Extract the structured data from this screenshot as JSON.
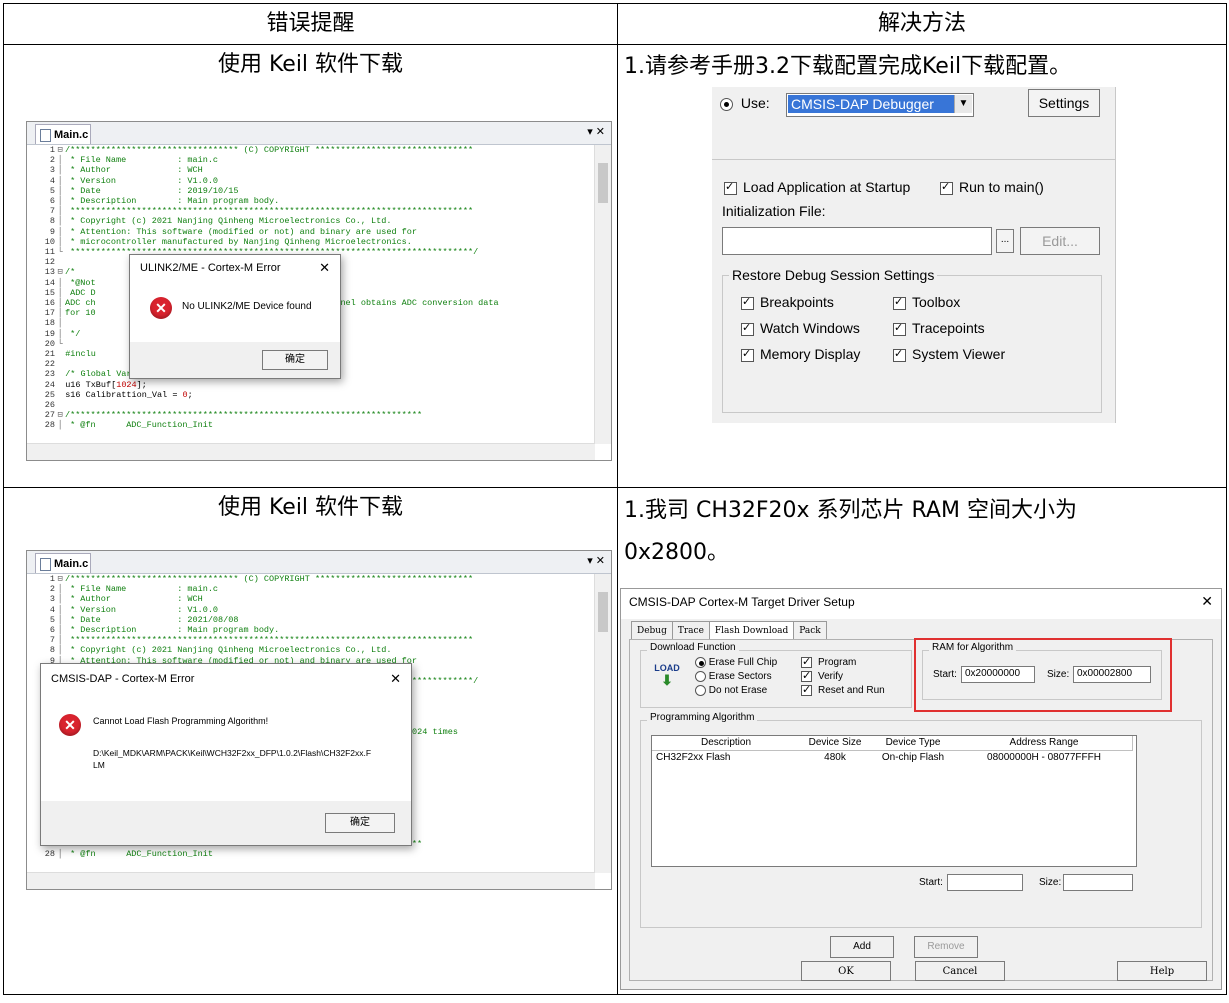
{
  "table": {
    "headers": [
      "错误提醒",
      "解决方法"
    ]
  },
  "row1": {
    "left_title": "使用 Keil 软件下载",
    "right_text": "1.请参考手册3.2下载配置完成Keil下载配置。",
    "editor": {
      "tab": "Main.c",
      "dates": "2019/10/15"
    },
    "dialog": {
      "title": "ULINK2/ME - Cortex-M Error",
      "message": "No ULINK2/ME Device found",
      "ok": "确定"
    },
    "debug_settings": {
      "use_label": "Use:",
      "debugger": "CMSIS-DAP Debugger",
      "settings_btn": "Settings",
      "load_app": "Load Application at Startup",
      "run_to_main": "Run to main()",
      "init_file": "Initialization File:",
      "browse_btn": "...",
      "edit_btn": "Edit...",
      "restore_group": "Restore Debug Session Settings",
      "breakpoints": "Breakpoints",
      "toolbox": "Toolbox",
      "watch_windows": "Watch Windows",
      "tracepoints": "Tracepoints",
      "memory_display": "Memory Display",
      "system_viewer": "System Viewer"
    }
  },
  "row2": {
    "left_title": "使用 Keil 软件下载",
    "right_text_1": "1.我司 CH32F20x 系列芯片 RAM 空间大小为",
    "right_text_2": "0x2800。",
    "editor": {
      "tab": "Main.c"
    },
    "dialog": {
      "title": "CMSIS-DAP - Cortex-M Error",
      "message": "Cannot Load Flash Programming Algorithm!",
      "path_1": "D:\\Keil_MDK\\ARM\\PACK\\Keil\\WCH32F2xx_DFP\\1.0.2\\Flash\\CH32F2xx.F",
      "path_2": "LM",
      "ok": "确定",
      "behind_text": "ns 1024 times"
    },
    "target_setup": {
      "title": "CMSIS-DAP Cortex-M Target Driver Setup",
      "tabs": [
        "Debug",
        "Trace",
        "Flash Download",
        "Pack"
      ],
      "download_function": "Download Function",
      "load_icon": "LOAD",
      "erase_full_chip": "Erase Full Chip",
      "erase_sectors": "Erase Sectors",
      "do_not_erase": "Do not Erase",
      "program": "Program",
      "verify": "Verify",
      "reset_and_run": "Reset and Run",
      "ram_group": "RAM for Algorithm",
      "start_label": "Start:",
      "start_value": "0x20000000",
      "size_label": "Size:",
      "size_value": "0x00002800",
      "prog_algo": "Programming Algorithm",
      "col_description": "Description",
      "col_device_size": "Device Size",
      "col_device_type": "Device Type",
      "col_address_range": "Address Range",
      "row_description": "CH32F2xx Flash",
      "row_device_size": "480k",
      "row_device_type": "On-chip Flash",
      "row_address_range": "08000000H - 08077FFFH",
      "start2": "Start:",
      "size2": "Size:",
      "add_btn": "Add",
      "remove_btn": "Remove",
      "ok_btn": "OK",
      "cancel_btn": "Cancel",
      "help_btn": "Help"
    }
  },
  "code_common": {
    "l1": "/********************************* (C) COPYRIGHT *******************************",
    "l2": " * File Name          : main.c",
    "l3": " * Author             : WCH",
    "l4": " * Version            : V1.0.0",
    "l5_label": " * Date               : ",
    "l5_date_a": "2019/10/15",
    "l5_date_b": "2021/08/08",
    "l6": " * Description        : Main program body.",
    "l7": " *******************************************************************************",
    "l8": " * Copyright (c) 2021 Nanjing Qinheng Microelectronics Co., Ltd.",
    "l9": " * Attention: This software (modified or not) and binary are used for",
    "l10": " * microcontroller manufactured by Nanjing Qinheng Microelectronics.",
    "l11": " *******************************************************************************/",
    "l13": "/*",
    "l14": " *@Not",
    "l15": " ADC D",
    "l16a": "ADC ch",
    "l16b": "annel obtains ADC conversion data",
    "l17": "for 10",
    "l19": " */",
    "l21": "#inclu",
    "l23": "/* Global Variable */",
    "l24a": "u16 TxBuf[",
    "l24n": "1024",
    "l24b": "];",
    "l25a": "s16 Calibrattion_Val = ",
    "l25n": "0",
    "l25b": ";",
    "l27": "/*********************************************************************",
    "l28": " * @fn      ADC_Function_Init"
  }
}
